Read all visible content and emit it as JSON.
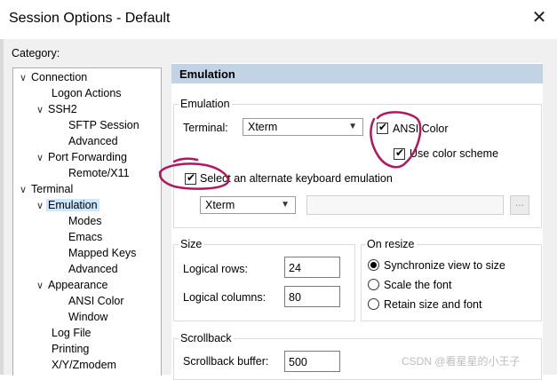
{
  "window": {
    "title": "Session Options - Default"
  },
  "category": {
    "label": "Category:",
    "items": [
      {
        "label": "Connection"
      },
      {
        "label": "Logon Actions"
      },
      {
        "label": "SSH2"
      },
      {
        "label": "SFTP Session"
      },
      {
        "label": "Advanced"
      },
      {
        "label": "Port Forwarding"
      },
      {
        "label": "Remote/X11"
      },
      {
        "label": "Terminal"
      },
      {
        "label": "Emulation"
      },
      {
        "label": "Modes"
      },
      {
        "label": "Emacs"
      },
      {
        "label": "Mapped Keys"
      },
      {
        "label": "Advanced"
      },
      {
        "label": "Appearance"
      },
      {
        "label": "ANSI Color"
      },
      {
        "label": "Window"
      },
      {
        "label": "Log File"
      },
      {
        "label": "Printing"
      },
      {
        "label": "X/Y/Zmodem"
      }
    ]
  },
  "panel": {
    "header": "Emulation",
    "emulation": {
      "group_title": "Emulation",
      "terminal_label": "Terminal:",
      "terminal_value": "Xterm",
      "ansi_color_label": "ANSI Color",
      "ansi_color_checked": true,
      "color_scheme_label": "Use color scheme",
      "color_scheme_checked": true,
      "alt_keyboard_label": "Select an alternate keyboard emulation",
      "alt_keyboard_checked": true,
      "keyboard_value": "Xterm",
      "browse_label": "..."
    },
    "size": {
      "group_title": "Size",
      "rows_label": "Logical rows:",
      "rows_value": "24",
      "cols_label": "Logical columns:",
      "cols_value": "80"
    },
    "on_resize": {
      "group_title": "On resize",
      "options": [
        {
          "label": "Synchronize view to size",
          "selected": true
        },
        {
          "label": "Scale the font",
          "selected": false
        },
        {
          "label": "Retain size and font",
          "selected": false
        }
      ]
    },
    "scrollback": {
      "group_title": "Scrollback",
      "buffer_label": "Scrollback buffer:",
      "buffer_value": "500"
    }
  },
  "watermark": "CSDN @看星星的小王子",
  "colors": {
    "selection": "#cce8ff",
    "header": "#c2d3e4",
    "annotation": "#b5155e"
  }
}
